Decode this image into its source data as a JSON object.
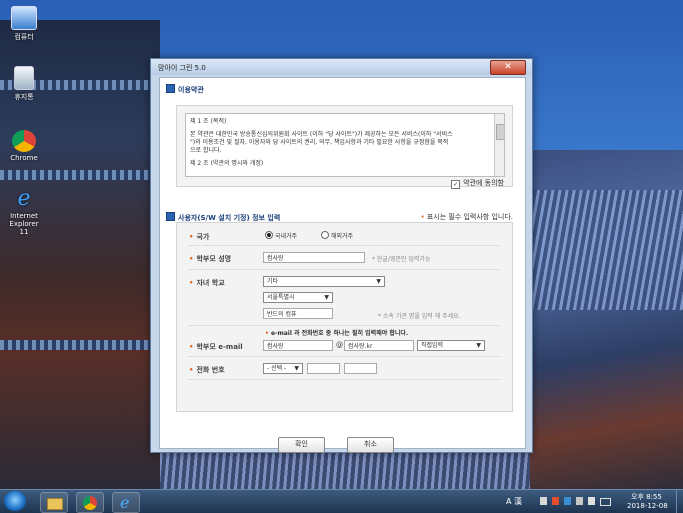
{
  "desktop": {
    "icons": [
      {
        "label": "컴퓨터",
        "icon": "computer-icon"
      },
      {
        "label": "휴지통",
        "icon": "recycle-bin-icon"
      },
      {
        "label": "Chrome",
        "icon": "chrome-icon"
      },
      {
        "label": "Internet Explorer 11",
        "icon": "internet-explorer-icon"
      }
    ]
  },
  "window": {
    "title": "맘아이 그린 5.0",
    "close": "✕"
  },
  "terms": {
    "heading": "이용약관",
    "text": [
      "제 1 조 (목적)",
      "본 약관은 대한민국 방송통신심의위원회 사이트 (이하 \"당 사이트\")가 제공하는 모든 서비스(이하 \"서비스",
      "\")의 이용조건 및 절차, 이용자와 당 사이트의 권리, 의무, 책임사항과 기타 필요한 사항을 규정함을 목적",
      "으로 합니다.",
      "제 2 조 (약관의 명시와 개정)"
    ],
    "agree_label": "약관에 동의함",
    "agree_checked": true
  },
  "user_info": {
    "heading": "사용자(S/W 설치 기정) 정보 입력",
    "required_note": "표시는 필수 입력사항 입니다."
  },
  "form": {
    "country": {
      "label": "국가",
      "options": [
        "국내거주",
        "해외거주"
      ],
      "selected": 0
    },
    "parent_name": {
      "label": "학부모 성명",
      "value": "컴사랑",
      "hint": "* 한글/영문만 입력가능"
    },
    "child_school": {
      "label": "자녀 학교",
      "school_type": "기타",
      "region": "서울특별시",
      "school_name": "반드의 컴퓨",
      "hint": "* 소속 기관 명을 입력 해 주세요."
    },
    "contact_notice": "e-mail 과 전화번호 중 하나는 필히 입력해야 합니다.",
    "email": {
      "label": "학부모 e-mail",
      "id": "컴사랑",
      "at": "@",
      "domain": "컴사랑.kr",
      "domain_select": "직접입력"
    },
    "phone": {
      "label": "전화 번호",
      "prefix": "- 선택 -",
      "middle": "",
      "last": ""
    }
  },
  "buttons": {
    "confirm": "확인",
    "cancel": "취소"
  },
  "taskbar": {
    "apps": [
      "explorer-icon",
      "chrome-icon",
      "internet-explorer-icon"
    ],
    "ime": "A 漢",
    "time": "오후 8:55",
    "date": "2018-12-08"
  },
  "colors": {
    "accent": "#2a63b3",
    "required": "#e06010",
    "title_close": "#c9432c"
  }
}
